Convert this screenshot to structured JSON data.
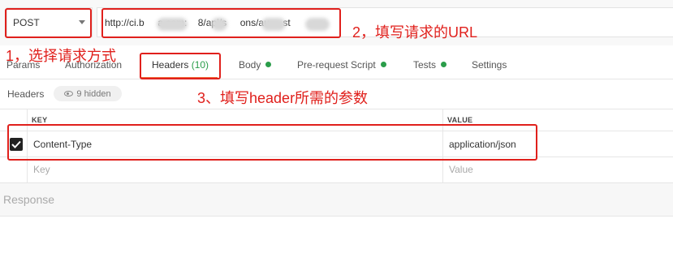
{
  "request": {
    "method": "POST",
    "url_text": "http://ci.b     a.com:    8/api/s     ons/au     st"
  },
  "tabs": [
    {
      "label": "Params"
    },
    {
      "label": "Authorization"
    },
    {
      "label": "Headers",
      "count": "(10)",
      "active": true
    },
    {
      "label": "Body",
      "has_dot": true
    },
    {
      "label": "Pre-request Script",
      "has_dot": true
    },
    {
      "label": "Tests",
      "has_dot": true
    },
    {
      "label": "Settings"
    }
  ],
  "headers_bar": {
    "label": "Headers",
    "hidden_text": "9 hidden"
  },
  "table": {
    "columns": {
      "key": "KEY",
      "value": "VALUE"
    },
    "rows": [
      {
        "checked": true,
        "key": "Content-Type",
        "value": "application/json"
      }
    ],
    "placeholder": {
      "key": "Key",
      "value": "Value"
    }
  },
  "response": {
    "label": "Response"
  },
  "annotations": {
    "step1": "1，选择请求方式",
    "step2": "2，填写请求的URL",
    "step3": "3、填写header所需的参数",
    "color": "#e0201c"
  },
  "colors": {
    "accent_underline": "#f26b3a",
    "status_green": "#2a9d4a"
  }
}
